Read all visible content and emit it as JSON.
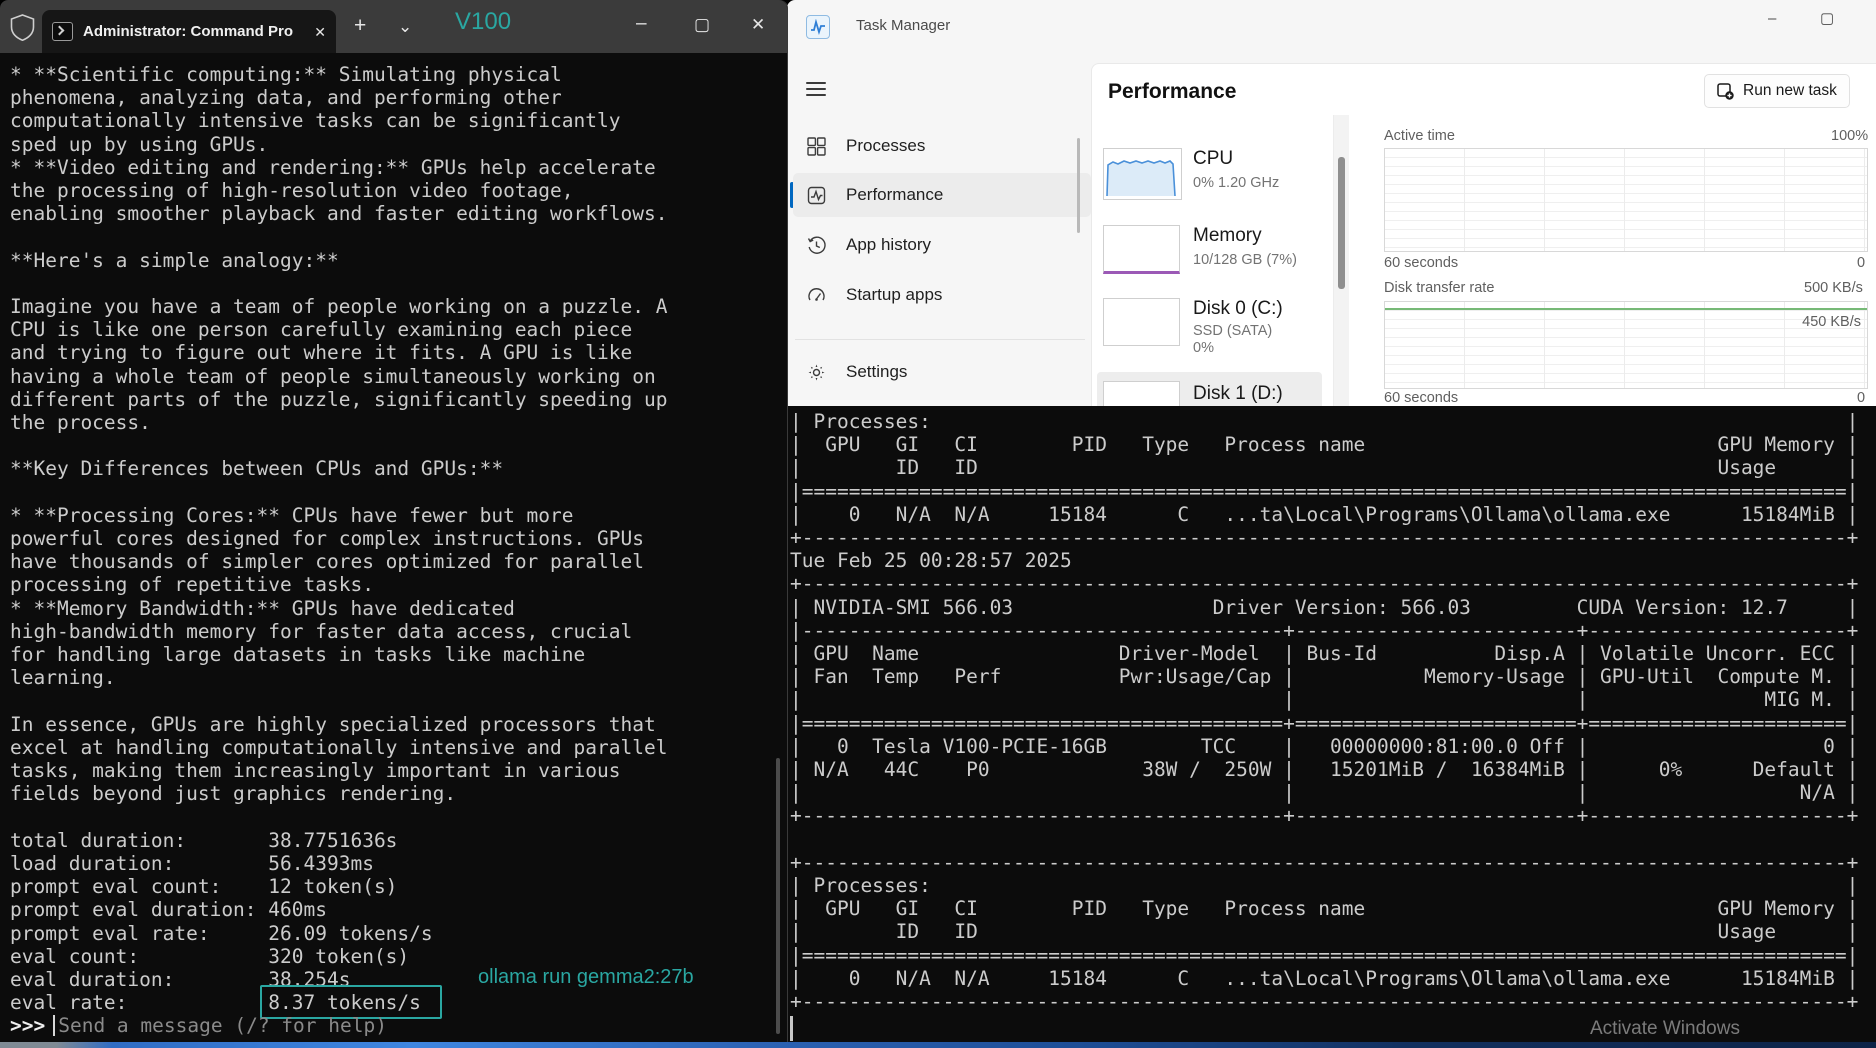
{
  "annotations": {
    "v100_label": "V100",
    "ollama_cmd": "ollama run gemma2:27b",
    "accent_color": "#2aa7a2",
    "highlighted_value": "8.37 tokens/s"
  },
  "left_terminal": {
    "tab_title": "Administrator: Command Pro",
    "icons": {
      "close_tab": "✕",
      "new_tab": "+",
      "dropdown": "⌄",
      "minimize": "–",
      "maximize": "▢",
      "close": "✕"
    },
    "body_lines": [
      "* **Scientific computing:** Simulating physical",
      "phenomena, analyzing data, and performing other",
      "computationally intensive tasks can be significantly",
      "sped up by using GPUs.",
      "* **Video editing and rendering:** GPUs help accelerate",
      "the processing of high-resolution video footage,",
      "enabling smoother playback and faster editing workflows.",
      "",
      "**Here's a simple analogy:**",
      "",
      "Imagine you have a team of people working on a puzzle. A",
      "CPU is like one person carefully examining each piece",
      "and trying to figure out where it fits. A GPU is like",
      "having a whole team of people simultaneously working on",
      "different parts of the puzzle, significantly speeding up",
      "the process.",
      "",
      "**Key Differences between CPUs and GPUs:**",
      "",
      "* **Processing Cores:** CPUs have fewer but more",
      "powerful cores designed for complex instructions. GPUs",
      "have thousands of simpler cores optimized for parallel",
      "processing of repetitive tasks.",
      "* **Memory Bandwidth:** GPUs have dedicated",
      "high-bandwidth memory for faster data access, crucial",
      "for handling large datasets in tasks like machine",
      "learning.",
      "",
      "In essence, GPUs are highly specialized processors that",
      "excel at handling computationally intensive and parallel",
      "tasks, making them increasingly important in various",
      "fields beyond just graphics rendering.",
      "",
      "total duration:       38.7751636s",
      "load duration:        56.4393ms",
      "prompt eval count:    12 token(s)",
      "prompt eval duration: 460ms",
      "prompt eval rate:     26.09 tokens/s",
      "eval count:           320 token(s)",
      "eval duration:        38.254s",
      "eval rate:            8.37 tokens/s"
    ],
    "prompt": {
      "marker": ">>>",
      "placeholder": "Send a message (/? for help)"
    }
  },
  "task_manager": {
    "title": "Task Manager",
    "window_icons": {
      "minimize": "–",
      "maximize": "▢",
      "close": "✕"
    },
    "nav": [
      {
        "label": "Processes"
      },
      {
        "label": "Performance",
        "selected": true
      },
      {
        "label": "App history"
      },
      {
        "label": "Startup apps"
      }
    ],
    "settings_label": "Settings",
    "page_title": "Performance",
    "run_new_task_label": "Run new task",
    "perf_items": [
      {
        "name": "CPU",
        "detail": "0%  1.20 GHz"
      },
      {
        "name": "Memory",
        "detail": "10/128 GB (7%)"
      },
      {
        "name": "Disk 0 (C:)",
        "detail": "SSD (SATA)",
        "detail2": "0%"
      },
      {
        "name": "Disk 1 (D:)"
      }
    ],
    "charts": {
      "active_time": {
        "label": "Active time",
        "max": "100%",
        "x_label": "60 seconds",
        "min": "0"
      },
      "transfer": {
        "label": "Disk transfer rate",
        "max": "500 KB/s",
        "current": "450 KB/s",
        "x_label": "60 seconds",
        "min": "0"
      }
    }
  },
  "right_terminal": {
    "lines": [
      "| Processes:                                                                              |",
      "|  GPU   GI   CI        PID   Type   Process name                              GPU Memory |",
      "|        ID   ID                                                               Usage      |",
      "|=========================================================================================|",
      "|    0   N/A  N/A     15184      C   ...ta\\Local\\Programs\\Ollama\\ollama.exe      15184MiB |",
      "+-----------------------------------------------------------------------------------------+",
      "Tue Feb 25 00:28:57 2025",
      "+-----------------------------------------------------------------------------------------+",
      "| NVIDIA-SMI 566.03                 Driver Version: 566.03         CUDA Version: 12.7     |",
      "|-----------------------------------------+------------------------+----------------------+",
      "| GPU  Name                 Driver-Model  | Bus-Id          Disp.A | Volatile Uncorr. ECC |",
      "| Fan  Temp   Perf          Pwr:Usage/Cap |           Memory-Usage | GPU-Util  Compute M. |",
      "|                                         |                        |               MIG M. |",
      "|=========================================+========================+======================|",
      "|   0  Tesla V100-PCIE-16GB        TCC    |   00000000:81:00.0 Off |                    0 |",
      "| N/A   44C    P0             38W /  250W |   15201MiB /  16384MiB |      0%      Default |",
      "|                                         |                        |                  N/A |",
      "+-----------------------------------------+------------------------+----------------------+",
      "",
      "+-----------------------------------------------------------------------------------------+",
      "| Processes:                                                                              |",
      "|  GPU   GI   CI        PID   Type   Process name                              GPU Memory |",
      "|        ID   ID                                                               Usage      |",
      "|=========================================================================================|",
      "|    0   N/A  N/A     15184      C   ...ta\\Local\\Programs\\Ollama\\ollama.exe      15184MiB |",
      "+-----------------------------------------------------------------------------------------+"
    ],
    "watermark": "Activate Windows"
  }
}
